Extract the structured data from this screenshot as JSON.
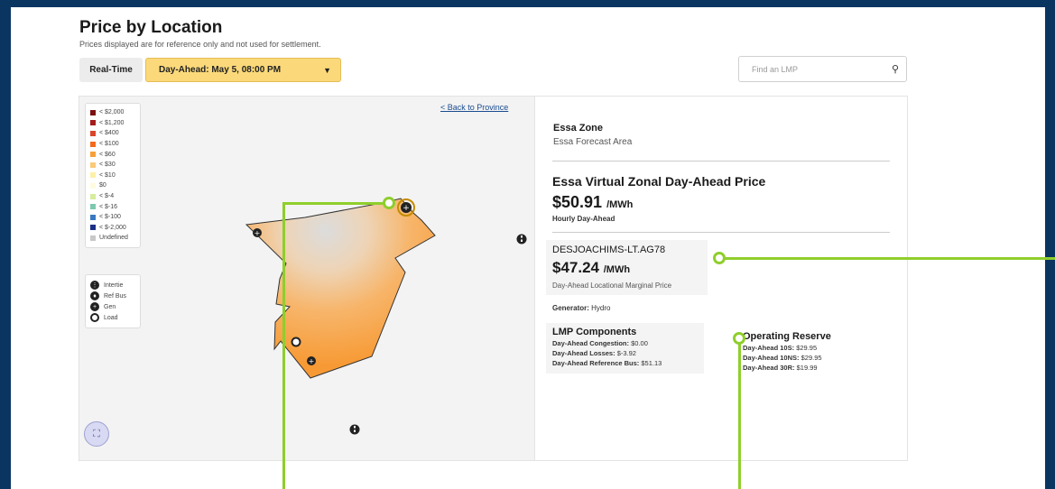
{
  "header": {
    "title": "Price by Location",
    "subtitle": "Prices displayed are for reference only and not used for settlement."
  },
  "controls": {
    "realtime_label": "Real-Time",
    "dayahead_selected": "Day-Ahead: May 5, 08:00 PM",
    "search_placeholder": "Find an LMP"
  },
  "legend": {
    "price_items": [
      {
        "label": "< $2,000",
        "color": "#7a1010"
      },
      {
        "label": "< $1,200",
        "color": "#a51c1c"
      },
      {
        "label": "< $400",
        "color": "#d9462a"
      },
      {
        "label": "< $100",
        "color": "#f26b1d"
      },
      {
        "label": "< $60",
        "color": "#f7a03a"
      },
      {
        "label": "< $30",
        "color": "#fbc97a"
      },
      {
        "label": "< $10",
        "color": "#fdf0a8"
      },
      {
        "label": "$0",
        "color": "#fffbe0"
      },
      {
        "label": "< $-4",
        "color": "#d7ec9e"
      },
      {
        "label": "< $-16",
        "color": "#7fc8b0"
      },
      {
        "label": "< $-100",
        "color": "#3a78c2"
      },
      {
        "label": "< $-2,000",
        "color": "#1c2f86"
      },
      {
        "label": "Undefined",
        "color": "#c8c8c8"
      }
    ],
    "symbols": [
      {
        "label": "Intertie",
        "icon": "intertie-icon"
      },
      {
        "label": "Ref Bus",
        "icon": "ref-bus-icon"
      },
      {
        "label": "Gen",
        "icon": "gen-icon"
      },
      {
        "label": "Load",
        "icon": "load-icon"
      }
    ]
  },
  "map": {
    "back_link": "< Back to Province",
    "zone_fill_color": "#f7a03a"
  },
  "info": {
    "zone_name": "Essa Zone",
    "zone_area": "Essa Forecast Area",
    "zonal_title": "Essa Virtual Zonal Day-Ahead Price",
    "zonal_price": "$50.91",
    "zonal_unit": "/MWh",
    "zonal_caption": "Hourly Day-Ahead",
    "node_name": "DESJOACHIMS-LT.AG78",
    "node_price": "$47.24",
    "node_unit": "/MWh",
    "node_caption": "Day-Ahead Locational Marginal Price",
    "generator_label": "Generator:",
    "generator_value": "Hydro",
    "lmp_title": "LMP Components",
    "lmp_rows": [
      {
        "label": "Day-Ahead Congestion:",
        "value": "$0.00"
      },
      {
        "label": "Day-Ahead Losses:",
        "value": "$-3.92"
      },
      {
        "label": "Day-Ahead Reference Bus:",
        "value": "$51.13"
      }
    ],
    "reserve_title": "Operating Reserve",
    "reserve_rows": [
      {
        "label": "Day-Ahead 10S:",
        "value": "$29.95"
      },
      {
        "label": "Day-Ahead 10NS:",
        "value": "$29.95"
      },
      {
        "label": "Day-Ahead 30R:",
        "value": "$19.99"
      }
    ]
  },
  "colors": {
    "background": "#0b3561",
    "select_bg": "#fbd97a",
    "annotation": "#8fce2c",
    "link": "#1a4c8f"
  }
}
